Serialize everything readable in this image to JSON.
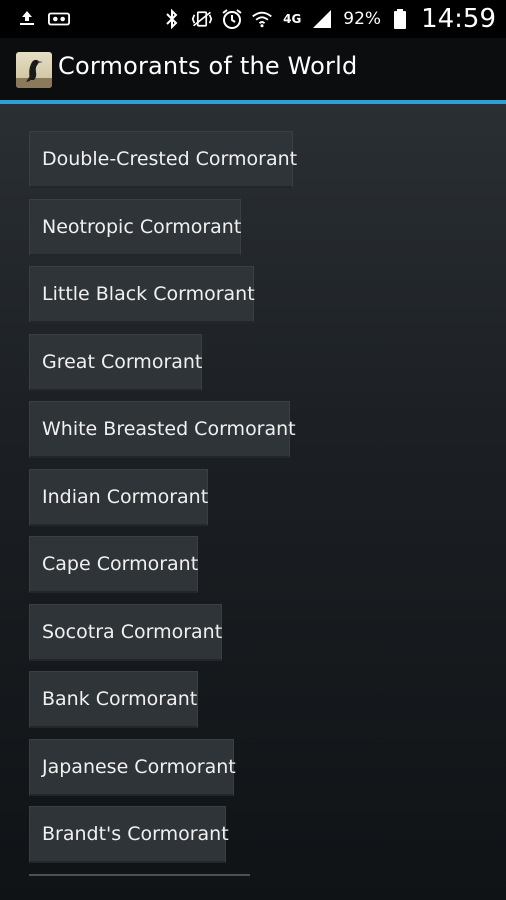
{
  "status_bar": {
    "battery_percent": "92%",
    "time": "14:59",
    "network_label": "4G",
    "notification_icons": [
      "upload-temp-icon",
      "voicemail-icon"
    ],
    "system_icons": [
      "bluetooth-icon",
      "vibrate-icon",
      "alarm-icon",
      "wifi-icon",
      "network-icon",
      "signal-icon",
      "battery-icon"
    ]
  },
  "action_bar": {
    "title": "Cormorants of the World",
    "app_icon": "cormorant-bird-icon"
  },
  "colors": {
    "accent": "#2f9ed6",
    "button_bg": "#2f3438",
    "background": "#1c2024"
  },
  "species_list": [
    {
      "label": "Double-Crested Cormorant"
    },
    {
      "label": "Neotropic Cormorant"
    },
    {
      "label": "Little Black Cormorant"
    },
    {
      "label": "Great Cormorant"
    },
    {
      "label": "White Breasted Cormorant"
    },
    {
      "label": "Indian Cormorant"
    },
    {
      "label": "Cape Cormorant"
    },
    {
      "label": "Socotra Cormorant"
    },
    {
      "label": "Bank Cormorant"
    },
    {
      "label": "Japanese Cormorant"
    },
    {
      "label": "Brandt's Cormorant"
    }
  ]
}
